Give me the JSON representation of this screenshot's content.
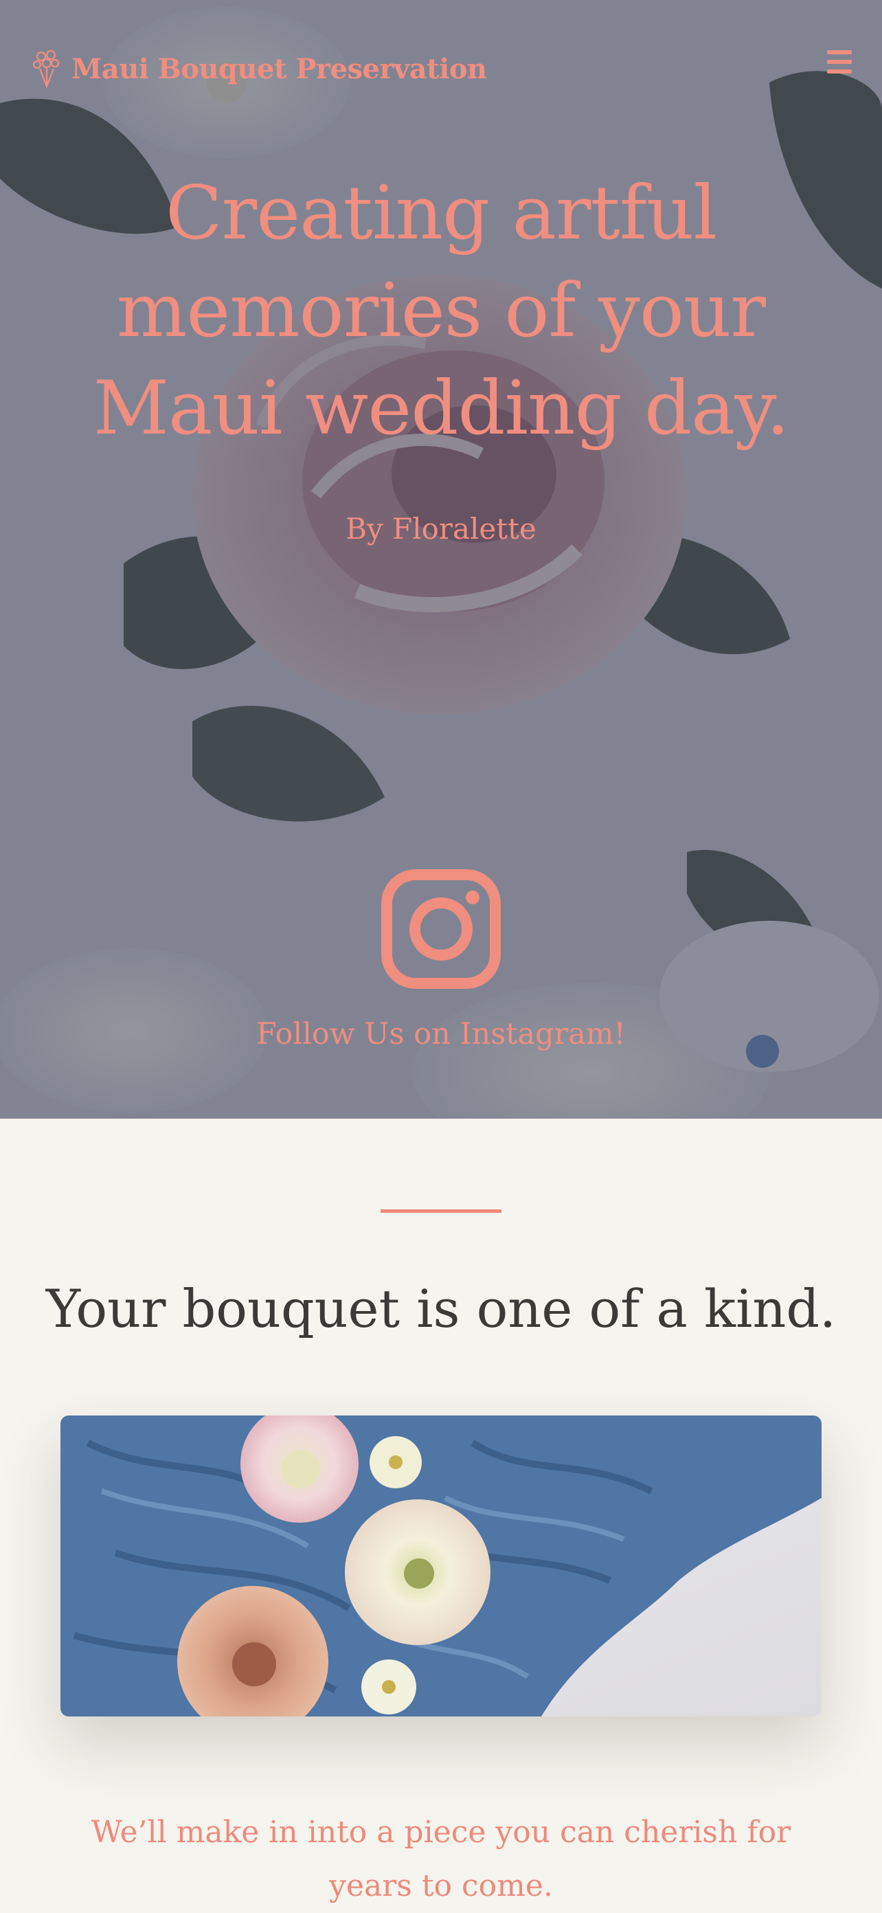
{
  "header": {
    "brand": "Maui Bouquet Preservation",
    "logo_icon": "bouquet-icon",
    "menu_icon": "hamburger-menu-icon"
  },
  "hero": {
    "title": "Creating artful memories of your Maui wedding day.",
    "subtitle": "By Floralette",
    "instagram_icon": "instagram-icon",
    "instagram_label": "Follow Us on Instagram!"
  },
  "section": {
    "title": "Your bouquet is one of a kind.",
    "tagline": "We’ll make in into a piece you can cherish for years to come."
  },
  "colors": {
    "accent": "#f08e80",
    "hero_overlay": "#4a4b5e",
    "background": "#f6f4ee",
    "heading": "#3b3a38",
    "fabric_blue": "#4f76a4"
  }
}
